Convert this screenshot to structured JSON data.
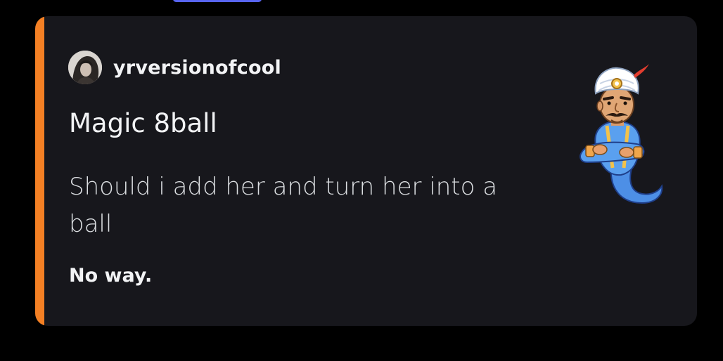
{
  "embed": {
    "author": {
      "name": "yrversionofcool",
      "avatar_icon": "user-avatar"
    },
    "title": "Magic 8ball",
    "description": "Should i add her and turn her into a ball",
    "answer": "No way.",
    "thumbnail_icon": "genie-icon",
    "accent_color": "#f48024"
  },
  "colors": {
    "page_background": "#000000",
    "embed_background": "#17171c",
    "tab_indicator": "#5865f2"
  }
}
